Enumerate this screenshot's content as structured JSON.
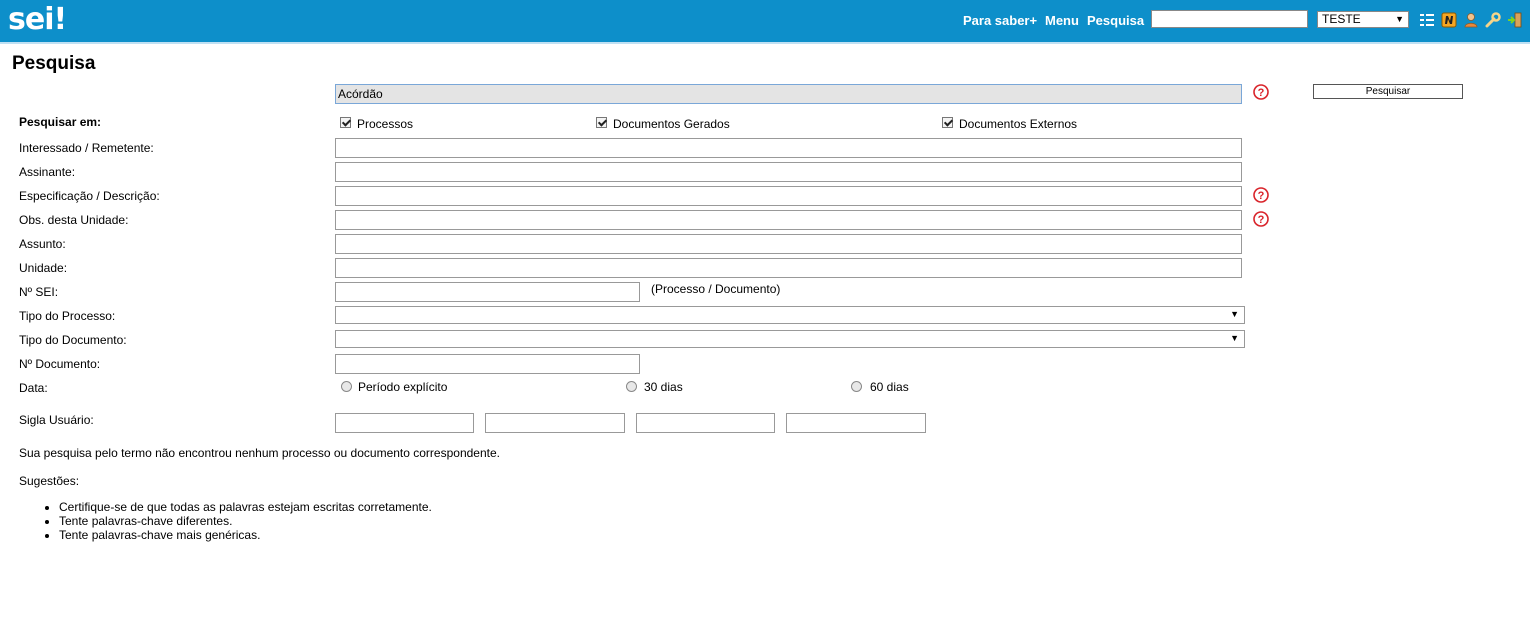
{
  "header": {
    "logo": "sei",
    "nav": [
      "Para saber+",
      "Menu",
      "Pesquisa"
    ],
    "search_value": "",
    "unit_select": "TESTE",
    "icons": [
      "list-icon",
      "notepad-icon",
      "user-icon",
      "wrench-icon",
      "exit-icon"
    ]
  },
  "page": {
    "title": "Pesquisa"
  },
  "form": {
    "query_value": "Acórdão",
    "search_button": "Pesquisar",
    "search_in_label": "Pesquisar em:",
    "search_in_options": [
      "Processos",
      "Documentos Gerados",
      "Documentos Externos"
    ],
    "interessado_label": "Interessado / Remetente:",
    "assinante_label": "Assinante:",
    "especificacao_label": "Especificação / Descrição:",
    "obs_label": "Obs. desta Unidade:",
    "assunto_label": "Assunto:",
    "unidade_label": "Unidade:",
    "nsei_label": "Nº SEI:",
    "nsei_hint": "(Processo / Documento)",
    "tipo_processo_label": "Tipo do Processo:",
    "tipo_documento_label": "Tipo do Documento:",
    "ndocumento_label": "Nº Documento:",
    "data_label": "Data:",
    "data_options": [
      "Período explícito",
      "30 dias",
      "60 dias"
    ],
    "sigla_label": "Sigla Usuário:"
  },
  "results": {
    "message": "Sua pesquisa pelo termo não encontrou nenhum processo ou documento correspondente.",
    "suggestions_label": "Sugestões:",
    "suggestions": [
      "Certifique-se de que todas as palavras estejam escritas corretamente.",
      "Tente palavras-chave diferentes.",
      "Tente palavras-chave mais genéricas."
    ]
  },
  "colors": {
    "header_bg": "#0d8fca",
    "help_icon": "#d9232a"
  }
}
